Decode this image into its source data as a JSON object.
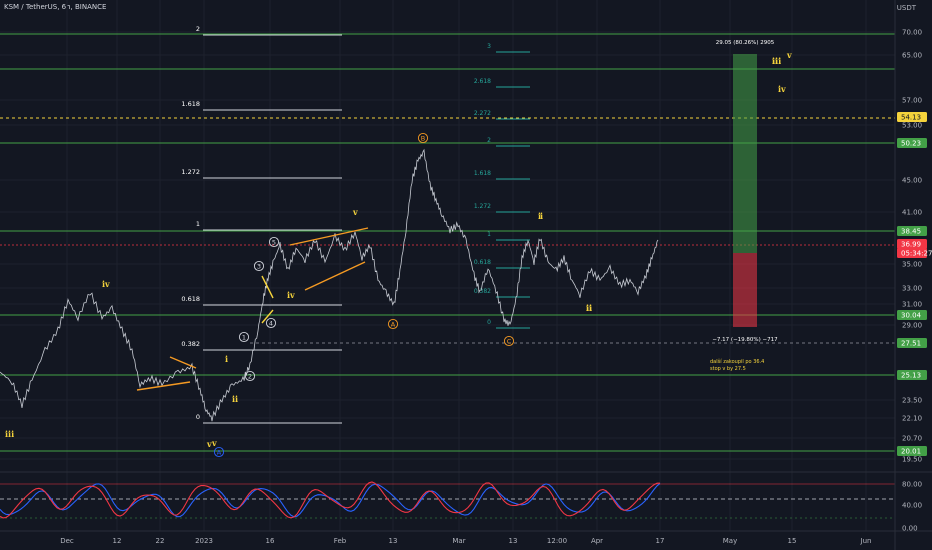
{
  "header": {
    "symbol_line": "KSM / TetherUS, 6h, BINANCE",
    "currency": "USDT"
  },
  "price_axis": {
    "ticks": [
      "70.00",
      "65.00",
      "57.00",
      "53.00",
      "45.00",
      "41.00",
      "35.00",
      "33.00",
      "31.00",
      "29.00",
      "23.50",
      "22.10",
      "20.70",
      "19.50"
    ],
    "badges": [
      {
        "label": "54.13",
        "bg": "#f5d33c",
        "fg": "#131722"
      },
      {
        "label": "50.23",
        "bg": "#43a047",
        "fg": "#ffffff"
      },
      {
        "label": "38.45",
        "bg": "#43a047",
        "fg": "#ffffff"
      },
      {
        "label": "36.99",
        "bg": "#f23645",
        "fg": "#ffffff"
      },
      {
        "label": "05:34:27",
        "bg": "#f23645",
        "fg": "#ffffff"
      },
      {
        "label": "30.04",
        "bg": "#43a047",
        "fg": "#ffffff"
      },
      {
        "label": "27.51",
        "bg": "#43a047",
        "fg": "#ffffff"
      },
      {
        "label": "25.13",
        "bg": "#43a047",
        "fg": "#ffffff"
      },
      {
        "label": "20.01",
        "bg": "#43a047",
        "fg": "#ffffff"
      }
    ]
  },
  "oscillator_axis": {
    "ticks": [
      "80.00",
      "40.00",
      "0.00"
    ]
  },
  "time_axis": {
    "labels": [
      "Dec",
      "12",
      "22",
      "2023",
      "16",
      "Feb",
      "13",
      "Mar",
      "13",
      "12:00",
      "Apr",
      "17",
      "May",
      "15",
      "Jun"
    ]
  },
  "fib_left": [
    "2",
    "1.618",
    "1.272",
    "1",
    "0.618",
    "0.382",
    "0"
  ],
  "fib_right": [
    "3",
    "2.618",
    "2.272",
    "2",
    "1.618",
    "1.272",
    "1",
    "0.618",
    "0.382",
    "0"
  ],
  "wave_labels": [
    "iii",
    "iv",
    "v",
    "iii",
    "iv",
    "v",
    "i",
    "ii",
    "i",
    "ii",
    "v",
    "i",
    "ii",
    "iii",
    "iv",
    "v"
  ],
  "circled_labels": [
    "1",
    "2",
    "3",
    "4",
    "5",
    "A",
    "B",
    "C",
    "A"
  ],
  "position_box": {
    "top_text": "29.05 (80.26%) 2905",
    "bottom_text": "−7.17 (−19.80%) −717",
    "note_line1": "další zakoupil po 36.4",
    "note_line2": "stop v by 27.5"
  },
  "colors": {
    "bg": "#131722",
    "green": "#43a047",
    "red": "#f23645",
    "yellow": "#f5d33c",
    "orange": "#f59a23",
    "blue": "#2962ff",
    "text": "#d1d4dc"
  }
}
